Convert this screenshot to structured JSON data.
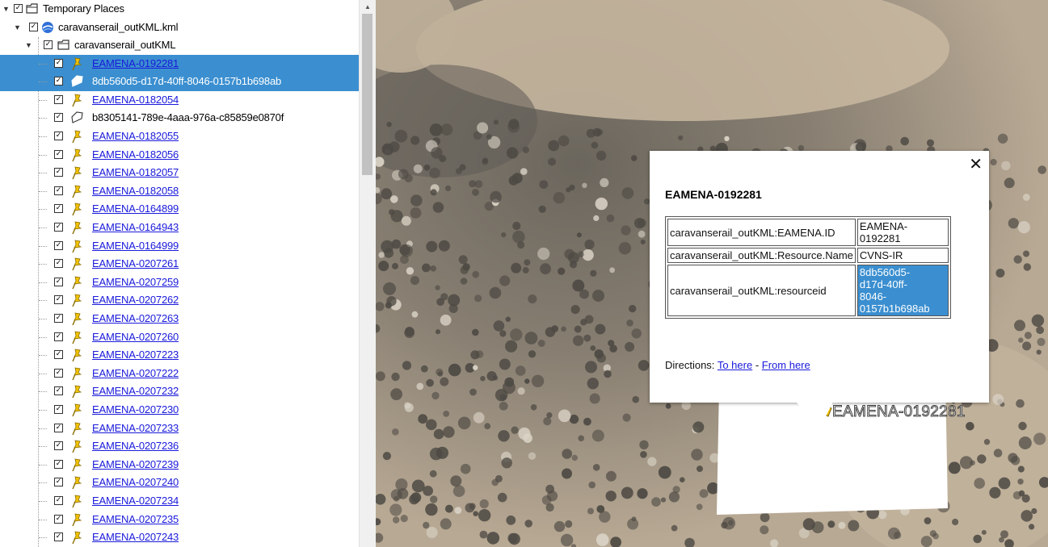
{
  "tree": {
    "root": {
      "label": "Temporary Places"
    },
    "kml_file": {
      "label": "caravanserail_outKML.kml"
    },
    "folder": {
      "label": "caravanserail_outKML"
    },
    "items": [
      {
        "label": "EAMENA-0192281",
        "type": "pin",
        "link": true,
        "selected": true
      },
      {
        "label": "8db560d5-d17d-40ff-8046-0157b1b698ab",
        "type": "polygon",
        "link": false,
        "selected": true
      },
      {
        "label": "EAMENA-0182054",
        "type": "pin",
        "link": true
      },
      {
        "label": "b8305141-789e-4aaa-976a-c85859e0870f",
        "type": "polygon",
        "link": false
      },
      {
        "label": "EAMENA-0182055",
        "type": "pin",
        "link": true
      },
      {
        "label": "EAMENA-0182056",
        "type": "pin",
        "link": true
      },
      {
        "label": "EAMENA-0182057",
        "type": "pin",
        "link": true
      },
      {
        "label": "EAMENA-0182058",
        "type": "pin",
        "link": true
      },
      {
        "label": "EAMENA-0164899",
        "type": "pin",
        "link": true
      },
      {
        "label": "EAMENA-0164943",
        "type": "pin",
        "link": true
      },
      {
        "label": "EAMENA-0164999",
        "type": "pin",
        "link": true
      },
      {
        "label": "EAMENA-0207261",
        "type": "pin",
        "link": true
      },
      {
        "label": "EAMENA-0207259",
        "type": "pin",
        "link": true
      },
      {
        "label": "EAMENA-0207262",
        "type": "pin",
        "link": true
      },
      {
        "label": "EAMENA-0207263",
        "type": "pin",
        "link": true
      },
      {
        "label": "EAMENA-0207260",
        "type": "pin",
        "link": true
      },
      {
        "label": "EAMENA-0207223",
        "type": "pin",
        "link": true
      },
      {
        "label": "EAMENA-0207222",
        "type": "pin",
        "link": true
      },
      {
        "label": "EAMENA-0207232",
        "type": "pin",
        "link": true
      },
      {
        "label": "EAMENA-0207230",
        "type": "pin",
        "link": true
      },
      {
        "label": "EAMENA-0207233",
        "type": "pin",
        "link": true
      },
      {
        "label": "EAMENA-0207236",
        "type": "pin",
        "link": true
      },
      {
        "label": "EAMENA-0207239",
        "type": "pin",
        "link": true
      },
      {
        "label": "EAMENA-0207240",
        "type": "pin",
        "link": true
      },
      {
        "label": "EAMENA-0207234",
        "type": "pin",
        "link": true
      },
      {
        "label": "EAMENA-0207235",
        "type": "pin",
        "link": true
      },
      {
        "label": "EAMENA-0207243",
        "type": "pin",
        "link": true
      }
    ]
  },
  "popup": {
    "title": "EAMENA-0192281",
    "rows": [
      {
        "key": "caravanserail_outKML:EAMENA.ID",
        "value": "EAMENA-\n0192281",
        "lines": [
          "EAMENA-",
          "0192281"
        ],
        "highlighted": false
      },
      {
        "key": "caravanserail_outKML:Resource.Name",
        "value": "CVNS-IR",
        "lines": [
          "CVNS-IR"
        ],
        "highlighted": false
      },
      {
        "key": "caravanserail_outKML:resourceid",
        "value": "8db560d5-d17d-40ff-8046-0157b1b698ab",
        "lines": [
          "8db560d5-",
          "d17d-40ff-",
          "8046-",
          "0157b1b698ab"
        ],
        "highlighted": true
      }
    ],
    "directions_label": "Directions:",
    "to_here": "To here",
    "separator": "-",
    "from_here": "From here",
    "close_icon": "close-icon"
  },
  "map": {
    "placemark_label": "EAMENA-0192281"
  },
  "colors": {
    "selection": "#3b8fd0",
    "link": "#1a1adb",
    "pin": "#f2c200"
  }
}
